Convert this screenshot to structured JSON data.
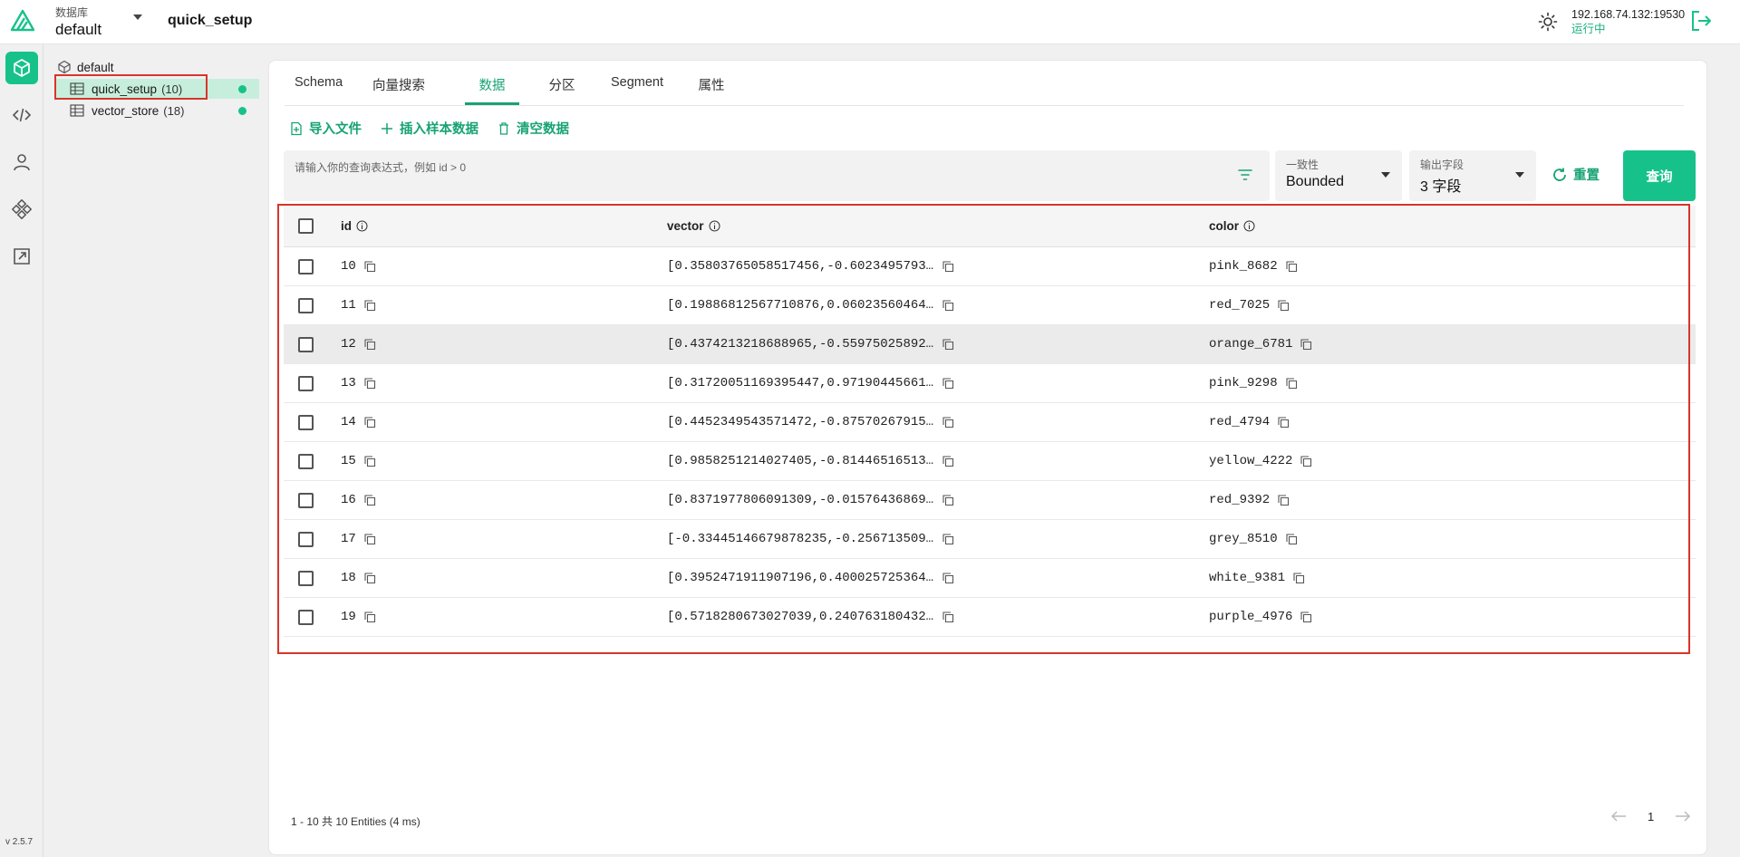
{
  "header": {
    "db_label": "数据库",
    "db_value": "default",
    "title": "quick_setup",
    "conn_address": "192.168.74.132:19530",
    "conn_status": "运行中"
  },
  "rail": {
    "items": [
      "database-icon",
      "code-icon",
      "user-icon",
      "system-icon",
      "playground-icon"
    ],
    "version": "v 2.5.7"
  },
  "tree": {
    "root": "default",
    "collections": [
      {
        "name": "quick_setup",
        "count": "(10)",
        "selected": true
      },
      {
        "name": "vector_store",
        "count": "(18)",
        "selected": false
      }
    ]
  },
  "tabs": [
    "Schema",
    "向量搜索",
    "数据",
    "分区",
    "Segment",
    "属性"
  ],
  "active_tab": "数据",
  "actions": {
    "import": "导入文件",
    "insert_sample": "插入样本数据",
    "clear": "清空数据"
  },
  "query": {
    "placeholder": "请输入你的查询表达式，例如 id > 0",
    "consistency_label": "一致性",
    "consistency_value": "Bounded",
    "output_label": "输出字段",
    "output_value": "3 字段",
    "reset_label": "重置",
    "query_label": "查询"
  },
  "table": {
    "columns": [
      "id",
      "vector",
      "color"
    ],
    "rows": [
      {
        "id": "10",
        "vector": "[0.35803765058517456,-0.6023495793...",
        "color": "pink_8682"
      },
      {
        "id": "11",
        "vector": "[0.19886812567710876,0.06023560464...",
        "color": "red_7025"
      },
      {
        "id": "12",
        "vector": "[0.4374213218688965,-0.55975025892...",
        "color": "orange_6781"
      },
      {
        "id": "13",
        "vector": "[0.31720051169395447,0.97190445661...",
        "color": "pink_9298"
      },
      {
        "id": "14",
        "vector": "[0.4452349543571472,-0.87570267915...",
        "color": "red_4794"
      },
      {
        "id": "15",
        "vector": "[0.9858251214027405,-0.81446516513...",
        "color": "yellow_4222"
      },
      {
        "id": "16",
        "vector": "[0.8371977806091309,-0.01576436869...",
        "color": "red_9392"
      },
      {
        "id": "17",
        "vector": "[-0.33445146679878235,-0.256713509...",
        "color": "grey_8510"
      },
      {
        "id": "18",
        "vector": "[0.3952471911907196,0.400025725364...",
        "color": "white_9381"
      },
      {
        "id": "19",
        "vector": "[0.5718280673027039,0.240763180432...",
        "color": "purple_4976"
      }
    ]
  },
  "footer": {
    "summary": "1 - 10  共 10 Entities (4 ms)",
    "page": "1"
  },
  "colors": {
    "accent": "#17c28a",
    "accent_text": "#17a372",
    "highlight": "#d9342b"
  }
}
